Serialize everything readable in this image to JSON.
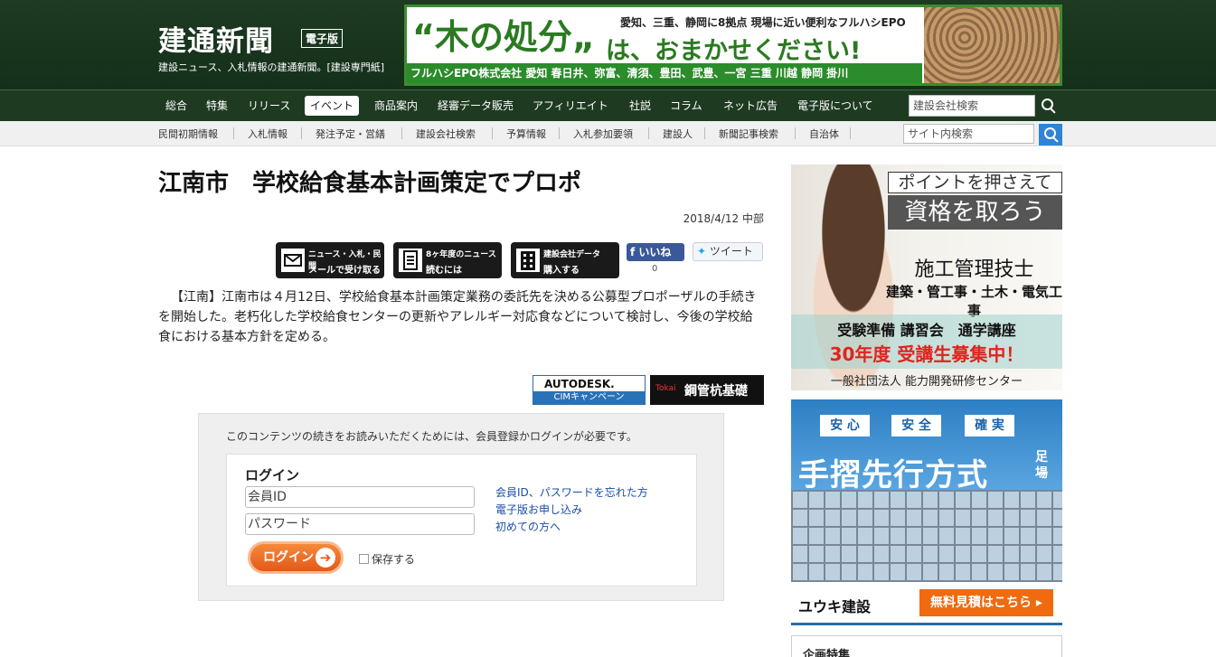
{
  "header": {
    "logo": "建通新聞",
    "edition_badge": "電子版",
    "tagline": "建設ニュース、入札情報の建通新聞。[建設専門紙]"
  },
  "top_ad": {
    "headline": "“木の処分„",
    "small_text": "愛知、三重、静岡に8拠点 現場に近い便利なフルハシEPO",
    "main_text": "は、おまかせください!",
    "bar_text": "フルハシEPO株式会社 愛知 春日井、弥富、清須、豊田、武豊、一宮 三重 川越 静岡 掛川"
  },
  "main_nav": {
    "items": [
      "総合",
      "特集",
      "リリース",
      "イベント",
      "商品案内",
      "経審データ販売",
      "アフィリエイト",
      "社説",
      "コラム",
      "ネット広告",
      "電子版について"
    ],
    "active_index": 3,
    "search_placeholder": "建設会社検索"
  },
  "sub_nav": {
    "items": [
      "民間初期情報",
      "入札情報",
      "発注予定・営繕",
      "建設会社検索",
      "予算情報",
      "入札参加要領",
      "建設人",
      "新聞記事検索",
      "自治体"
    ],
    "search_placeholder": "サイト内検索"
  },
  "article": {
    "title": "江南市　学校給食基本計画策定でプロポ",
    "date": "2018/4/12 中部",
    "buttons": [
      {
        "line1": "ニュース・入札・民間",
        "line2": "メールで受け取る"
      },
      {
        "line1": "8ヶ年度のニュース",
        "line2": "読むには"
      },
      {
        "line1": "建設会社データ",
        "line2": "購入する"
      }
    ],
    "like_label": "いいね",
    "like_count": "0",
    "tweet_label": "ツイート",
    "body": "【江南】江南市は４月12日、学校給食基本計画策定業務の委託先を決める公募型プロポーザルの手続きを開始した。老朽化した学校給食センターの更新やアレルギー対応食などについて検討し、今後の学校給食における基本方針を定める。",
    "badge_autodesk": "AUTODESK.",
    "badge_autodesk_sub": "CIMキャンペーン",
    "badge_steel": "鋼管杭基礎",
    "badge_steel_mark": "Tokai"
  },
  "login": {
    "notice": "このコンテンツの続きをお読みいただくためには、会員登録かログインが必要です。",
    "heading": "ログイン",
    "id_placeholder": "会員ID",
    "password_placeholder": "パスワード",
    "button_label": "ログイン",
    "remember_label": "保存する",
    "links": [
      "会員ID、パスワードを忘れた方",
      "電子版お申し込み",
      "初めての方へ"
    ]
  },
  "side_ad1": {
    "header1": "ポイントを押さえて",
    "header2": "資格を取ろう",
    "line1": "施工管理技士",
    "line2": "建築・管工事・土木・電気工事",
    "line3": "受験準備 講習会　通学講座",
    "line4": "30年度 受講生募集中！",
    "line5": "一般社団法人 能力開発研修センター"
  },
  "side_ad2": {
    "tags": [
      "安 心",
      "安 全",
      "確 実"
    ],
    "headline": "手摺先行方式",
    "footing": "足場",
    "company": "ユウキ建設",
    "cta": "無料見積はこちら ▸"
  },
  "side_box": {
    "title": "企画特集"
  }
}
